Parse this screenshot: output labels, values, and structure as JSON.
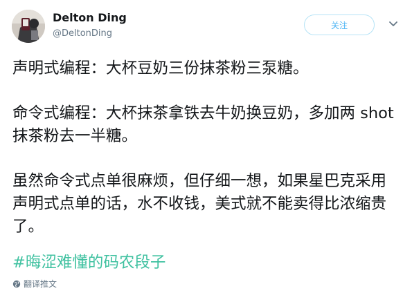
{
  "author": {
    "name": "Delton Ding",
    "handle": "@DeltonDing"
  },
  "actions": {
    "follow_label": "关注"
  },
  "tweet": {
    "paragraphs": [
      "声明式编程：大杯豆奶三份抹茶粉三泵糖。",
      "命令式编程：大杯抹茶拿铁去牛奶换豆奶，多加两 shot 抹茶粉去一半糖。",
      "虽然命令式点单很麻烦，但仔细一想，如果星巴克采用声明式点单的话，水不收钱，美式就不能卖得比浓缩贵了。"
    ],
    "hashtag": "#晦涩难懂的码农段子"
  },
  "translate_label": "翻译推文",
  "icons": {
    "avatar": "avatar-photo",
    "caret": "chevron-down-icon",
    "translate": "globe-icon"
  },
  "colors": {
    "accent": "#4ab3f4",
    "hashtag": "#3fc1a0",
    "muted": "#657786"
  }
}
